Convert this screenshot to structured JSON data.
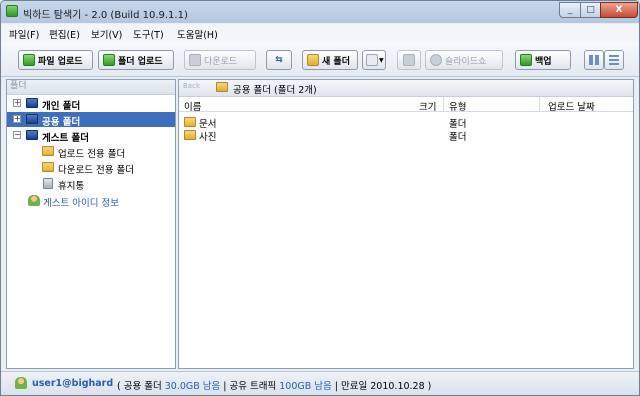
{
  "window": {
    "title": "빅하드 탐색기 - 2.0 (Build 10.9.1.1)",
    "minimize": "_",
    "maximize": "□",
    "close": "X"
  },
  "menu": [
    "파일(F)",
    "편집(E)",
    "보기(V)",
    "도구(T)",
    "도움말(H)"
  ],
  "toolbar": {
    "file_upload": "파일 업로드",
    "folder_upload": "폴더 업로드",
    "download": "다운로드",
    "new_folder": "새 폴더",
    "slideshow": "슬라이드쇼",
    "backup": "백업",
    "refresh_icon": "⇆",
    "back_icon": "Back"
  },
  "tree": {
    "header": "폴더",
    "items": [
      {
        "label": "개인 폴더"
      },
      {
        "label": "공용 폴더"
      },
      {
        "label": "게스트 폴더"
      },
      {
        "label": "업로드 전용 폴더"
      },
      {
        "label": "다운로드 전용 폴더"
      },
      {
        "label": "휴지통"
      },
      {
        "label": "게스트 아이디 정보"
      }
    ]
  },
  "path": {
    "text": "공용 폴더 (폴더 2개)"
  },
  "columns": {
    "name": "이름",
    "size": "크기",
    "type": "유형",
    "date": "업로드 날짜"
  },
  "files": [
    {
      "name": "문서",
      "type": "폴더"
    },
    {
      "name": "사진",
      "type": "폴더"
    }
  ],
  "status": {
    "user": "user1@bighard",
    "p1": "( 공용 폴더 ",
    "free": "30.0GB 남음",
    "p2": " | 공유 트래픽 ",
    "traffic": "100GB 남음",
    "p3": " | 만료일 2010.10.28 )"
  }
}
